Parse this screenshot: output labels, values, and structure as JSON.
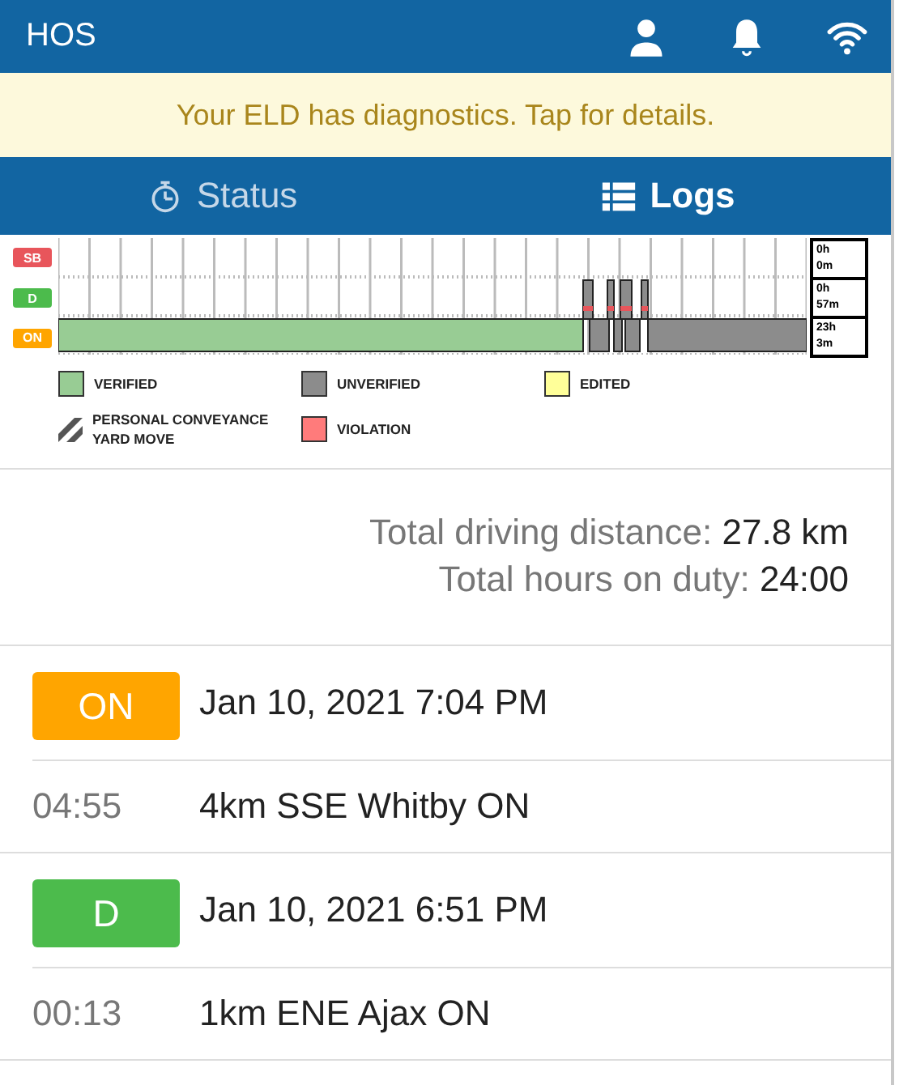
{
  "header": {
    "title": "HOS"
  },
  "banner": {
    "text": "Your ELD has diagnostics. Tap for details."
  },
  "tabs": [
    {
      "label": "Status",
      "kind": "stopwatch",
      "selected": false
    },
    {
      "label": "Logs",
      "kind": "list",
      "selected": true
    }
  ],
  "log_graph": {
    "rows": [
      {
        "label": "SB",
        "color": "#e8555b",
        "total": [
          "0h",
          "0m"
        ]
      },
      {
        "label": "D",
        "color": "#4cbb4c",
        "total": [
          "0h",
          "57m"
        ]
      },
      {
        "label": "ON",
        "color": "#ffa500",
        "total": [
          "23h",
          "3m"
        ]
      }
    ]
  },
  "legend": [
    {
      "kind": "swatch",
      "color": "#98cc94",
      "lines": [
        "VERIFIED"
      ]
    },
    {
      "kind": "swatch",
      "color": "#8c8c8c",
      "lines": [
        "UNVERIFIED"
      ]
    },
    {
      "kind": "swatch",
      "color": "#ffff99",
      "lines": [
        "EDITED"
      ]
    },
    {
      "kind": "striped",
      "lines": [
        "PERSONAL CONVEYANCE",
        "YARD MOVE"
      ]
    },
    {
      "kind": "swatch",
      "color": "#ff7b7b",
      "lines": [
        "VIOLATION"
      ]
    }
  ],
  "totals": [
    {
      "label": "Total driving distance:",
      "value": "27.8 km"
    },
    {
      "label": "Total hours on duty:",
      "value": "24:00"
    }
  ],
  "entries": [
    {
      "status": "ON",
      "color": "#ffa500",
      "date": "Jan 10, 2021 7:04 PM",
      "duration": "04:55",
      "location": "4km SSE Whitby ON"
    },
    {
      "status": "D",
      "color": "#4cbb4c",
      "date": "Jan 10, 2021 6:51 PM",
      "duration": "00:13",
      "location": "1km ENE Ajax ON"
    }
  ]
}
